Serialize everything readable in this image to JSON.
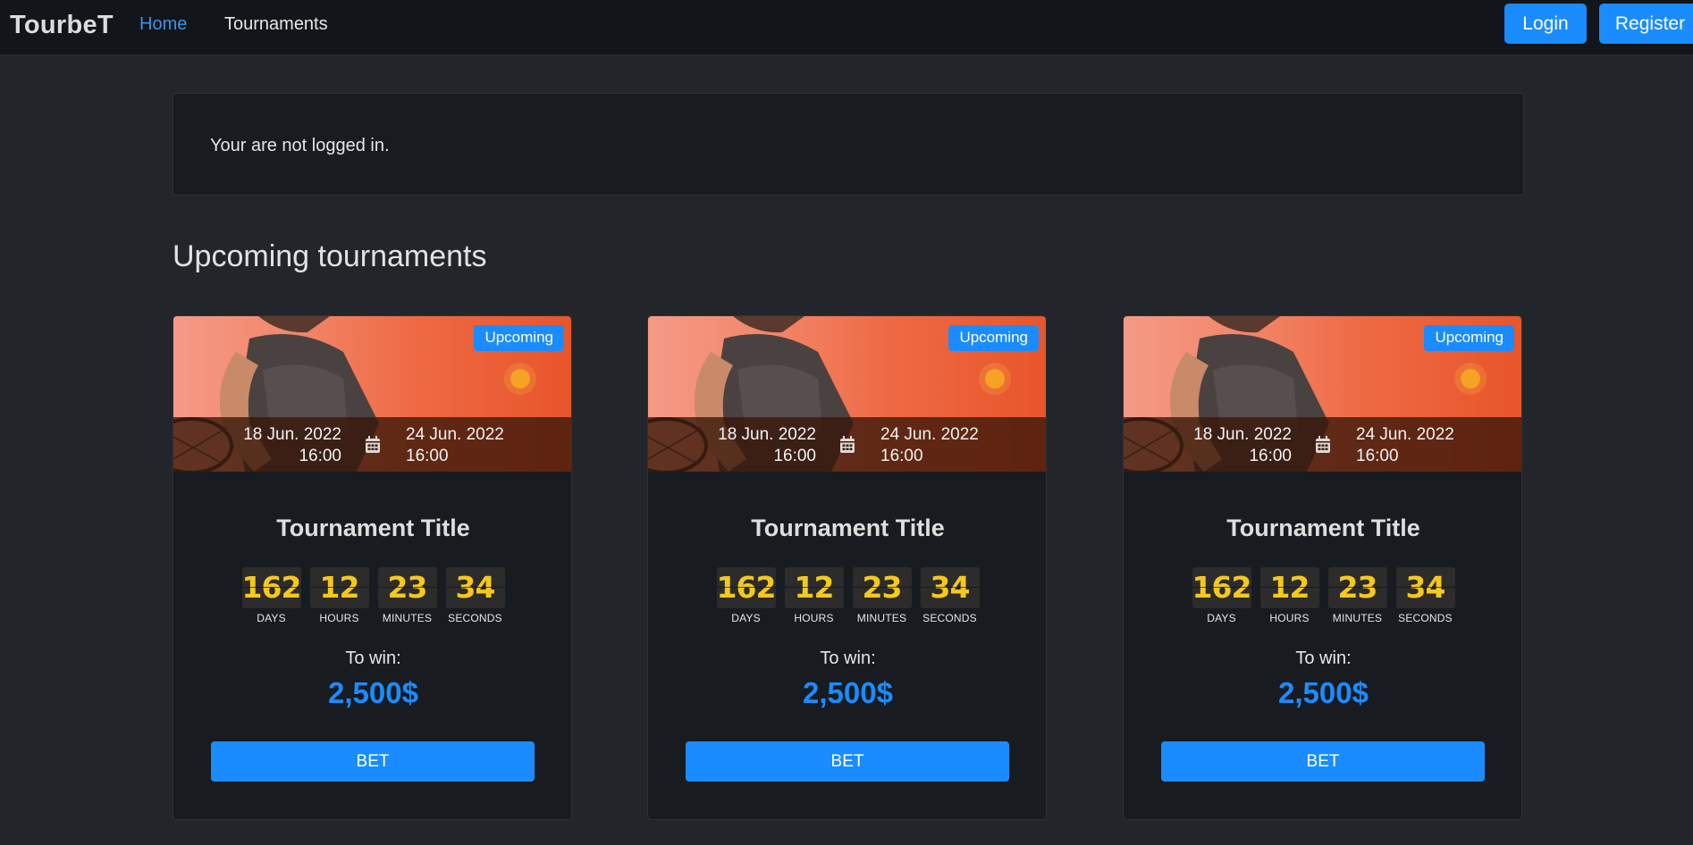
{
  "navbar": {
    "brand": "TourbeT",
    "links": [
      {
        "label": "Home",
        "active": true
      },
      {
        "label": "Tournaments",
        "active": false
      }
    ],
    "login_label": "Login",
    "register_label": "Register"
  },
  "alert": {
    "message": "Your are not logged in."
  },
  "section": {
    "title": "Upcoming tournaments"
  },
  "tournaments": [
    {
      "badge": "Upcoming",
      "start_date": "18 Jun. 2022",
      "start_time": "16:00",
      "end_date": "24 Jun. 2022",
      "end_time": "16:00",
      "title": "Tournament Title",
      "countdown": {
        "days": "162",
        "hours": "12",
        "minutes": "23",
        "seconds": "34"
      },
      "to_win_label": "To win:",
      "prize": "2,500$",
      "bet_label": "BET"
    },
    {
      "badge": "Upcoming",
      "start_date": "18 Jun. 2022",
      "start_time": "16:00",
      "end_date": "24 Jun. 2022",
      "end_time": "16:00",
      "title": "Tournament Title",
      "countdown": {
        "days": "162",
        "hours": "12",
        "minutes": "23",
        "seconds": "34"
      },
      "to_win_label": "To win:",
      "prize": "2,500$",
      "bet_label": "BET"
    },
    {
      "badge": "Upcoming",
      "start_date": "18 Jun. 2022",
      "start_time": "16:00",
      "end_date": "24 Jun. 2022",
      "end_time": "16:00",
      "title": "Tournament Title",
      "countdown": {
        "days": "162",
        "hours": "12",
        "minutes": "23",
        "seconds": "34"
      },
      "to_win_label": "To win:",
      "prize": "2,500$",
      "bet_label": "BET"
    }
  ],
  "countdown_labels": {
    "days": "DAYS",
    "hours": "HOURS",
    "minutes": "MINUTES",
    "seconds": "SECONDS"
  },
  "icons": {
    "date_separator": "calendar-icon"
  },
  "colors": {
    "accent": "#1a8cff",
    "countdown_digits": "#f5c81d",
    "background": "#222529",
    "navbar": "#121519",
    "card": "#181b20"
  }
}
